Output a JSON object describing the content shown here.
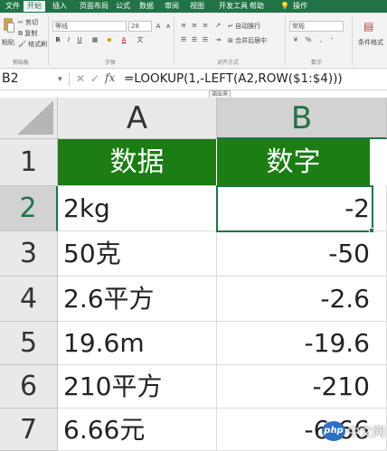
{
  "ribbon": {
    "tabs": [
      "文件",
      "开始",
      "插入",
      "页面布局",
      "公式",
      "数据",
      "审阅",
      "视图",
      "开发工具",
      "帮助"
    ],
    "active_tab": "开始",
    "search_hint": "操作",
    "clipboard": {
      "paste_label": "粘贴",
      "cut_label": "剪切",
      "copy_label": "复制",
      "format_painter_label": "格式刷",
      "group_label": "剪贴板"
    },
    "font": {
      "font_name": "等线",
      "font_size": "28",
      "grow_label": "A",
      "shrink_label": "A",
      "bold": "B",
      "italic": "I",
      "underline": "U",
      "font_color_label": "A",
      "wen_label": "文",
      "group_label": "字体"
    },
    "alignment": {
      "wrap_text_label": "自动换行",
      "merge_label": "合并后居中",
      "group_label": "对齐方式"
    },
    "number": {
      "format_value": "常规",
      "percent_label": "%",
      "comma_label": ",",
      "group_label": "数字"
    },
    "styles": {
      "conditional_label": "条件格式"
    }
  },
  "formula_bar": {
    "name_box": "B2",
    "cancel_icon": "✕",
    "enter_icon": "✓",
    "fx_label": "fx",
    "formula": "=LOOKUP(1,-LEFT(A2,ROW($1:$4)))",
    "tooltip": "调出来"
  },
  "sheet": {
    "columns": [
      "A",
      "B"
    ],
    "rows": [
      "1",
      "2",
      "3",
      "4",
      "5",
      "6",
      "7"
    ],
    "header_row": {
      "a": "数据",
      "b": "数字"
    },
    "data": [
      {
        "a": "2kg",
        "b": "-2"
      },
      {
        "a": "50克",
        "b": "-50"
      },
      {
        "a": "2.6平方",
        "b": "-2.6"
      },
      {
        "a": "19.6m",
        "b": "-19.6"
      },
      {
        "a": "210平方",
        "b": "-210"
      },
      {
        "a": "6.66元",
        "b": "-6.66"
      }
    ],
    "active_cell": "B2",
    "header_fill": "#1b7d14",
    "accent": "#217346"
  },
  "watermark": {
    "badge": "php",
    "text": "中文网"
  }
}
